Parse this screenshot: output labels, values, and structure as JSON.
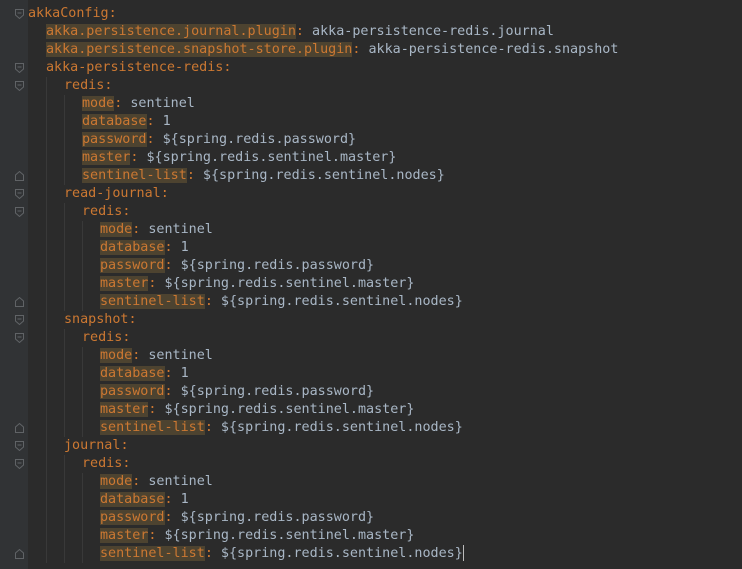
{
  "editor": {
    "lines": [
      {
        "depth": 0,
        "key": "akkaConfig",
        "value": "",
        "hl": false,
        "fold": "open"
      },
      {
        "depth": 1,
        "key": "akka.persistence.journal.plugin",
        "value": "akka-persistence-redis.journal",
        "hl": true,
        "fold": "none"
      },
      {
        "depth": 1,
        "key": "akka.persistence.snapshot-store.plugin",
        "value": "akka-persistence-redis.snapshot",
        "hl": true,
        "fold": "none"
      },
      {
        "depth": 1,
        "key": "akka-persistence-redis",
        "value": "",
        "hl": false,
        "fold": "open"
      },
      {
        "depth": 2,
        "key": "redis",
        "value": "",
        "hl": false,
        "fold": "open"
      },
      {
        "depth": 3,
        "key": "mode",
        "value": "sentinel",
        "hl": true,
        "fold": "none"
      },
      {
        "depth": 3,
        "key": "database",
        "value": "1",
        "hl": true,
        "fold": "none"
      },
      {
        "depth": 3,
        "key": "password",
        "value": "${spring.redis.password}",
        "hl": true,
        "fold": "none"
      },
      {
        "depth": 3,
        "key": "master",
        "value": "${spring.redis.sentinel.master}",
        "hl": true,
        "fold": "none"
      },
      {
        "depth": 3,
        "key": "sentinel-list",
        "value": "${spring.redis.sentinel.nodes}",
        "hl": true,
        "fold": "close"
      },
      {
        "depth": 2,
        "key": "read-journal",
        "value": "",
        "hl": false,
        "fold": "open"
      },
      {
        "depth": 3,
        "key": "redis",
        "value": "",
        "hl": false,
        "fold": "open"
      },
      {
        "depth": 4,
        "key": "mode",
        "value": "sentinel",
        "hl": true,
        "fold": "none"
      },
      {
        "depth": 4,
        "key": "database",
        "value": "1",
        "hl": true,
        "fold": "none"
      },
      {
        "depth": 4,
        "key": "password",
        "value": "${spring.redis.password}",
        "hl": true,
        "fold": "none"
      },
      {
        "depth": 4,
        "key": "master",
        "value": "${spring.redis.sentinel.master}",
        "hl": true,
        "fold": "none"
      },
      {
        "depth": 4,
        "key": "sentinel-list",
        "value": "${spring.redis.sentinel.nodes}",
        "hl": true,
        "fold": "close"
      },
      {
        "depth": 2,
        "key": "snapshot",
        "value": "",
        "hl": false,
        "fold": "open"
      },
      {
        "depth": 3,
        "key": "redis",
        "value": "",
        "hl": false,
        "fold": "open"
      },
      {
        "depth": 4,
        "key": "mode",
        "value": "sentinel",
        "hl": true,
        "fold": "none"
      },
      {
        "depth": 4,
        "key": "database",
        "value": "1",
        "hl": true,
        "fold": "none"
      },
      {
        "depth": 4,
        "key": "password",
        "value": "${spring.redis.password}",
        "hl": true,
        "fold": "none"
      },
      {
        "depth": 4,
        "key": "master",
        "value": "${spring.redis.sentinel.master}",
        "hl": true,
        "fold": "none"
      },
      {
        "depth": 4,
        "key": "sentinel-list",
        "value": "${spring.redis.sentinel.nodes}",
        "hl": true,
        "fold": "close"
      },
      {
        "depth": 2,
        "key": "journal",
        "value": "",
        "hl": false,
        "fold": "open"
      },
      {
        "depth": 3,
        "key": "redis",
        "value": "",
        "hl": false,
        "fold": "open"
      },
      {
        "depth": 4,
        "key": "mode",
        "value": "sentinel",
        "hl": true,
        "fold": "none"
      },
      {
        "depth": 4,
        "key": "database",
        "value": "1",
        "hl": true,
        "fold": "none"
      },
      {
        "depth": 4,
        "key": "password",
        "value": "${spring.redis.password}",
        "hl": true,
        "fold": "none"
      },
      {
        "depth": 4,
        "key": "master",
        "value": "${spring.redis.sentinel.master}",
        "hl": true,
        "fold": "none"
      },
      {
        "depth": 4,
        "key": "sentinel-list",
        "value": "${spring.redis.sentinel.nodes}",
        "hl": true,
        "fold": "close",
        "caret": true
      }
    ]
  },
  "colors": {
    "background": "#2b2b2b",
    "gutter": "#313335",
    "key": "#cc7832",
    "key_highlight": "#4d4330",
    "text": "#a9b7c6",
    "fold_marker": "#606366"
  },
  "icons": {
    "fold_open": "fold-open-icon",
    "fold_close": "fold-close-icon"
  }
}
